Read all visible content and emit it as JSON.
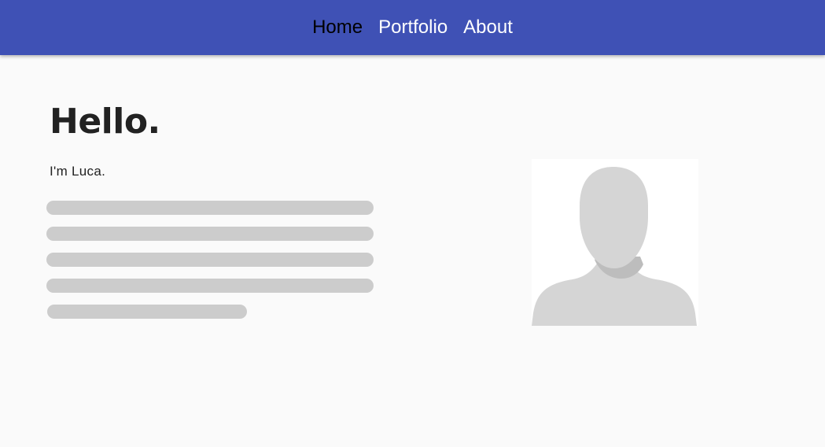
{
  "nav": {
    "items": [
      {
        "label": "Home",
        "active": true
      },
      {
        "label": "Portfolio",
        "active": false
      },
      {
        "label": "About",
        "active": false
      }
    ]
  },
  "main": {
    "heading": "Hello.",
    "intro": "I'm Luca."
  },
  "colors": {
    "navbar": "#3f51b5",
    "nav_active_text": "#000000",
    "nav_text": "#ffffff",
    "background": "#fafafa",
    "placeholder": "#cccccc",
    "avatar_silhouette": "#d5d5d5",
    "avatar_shadow": "#bdbdbd"
  },
  "avatar": {
    "icon": "default-user-silhouette"
  }
}
